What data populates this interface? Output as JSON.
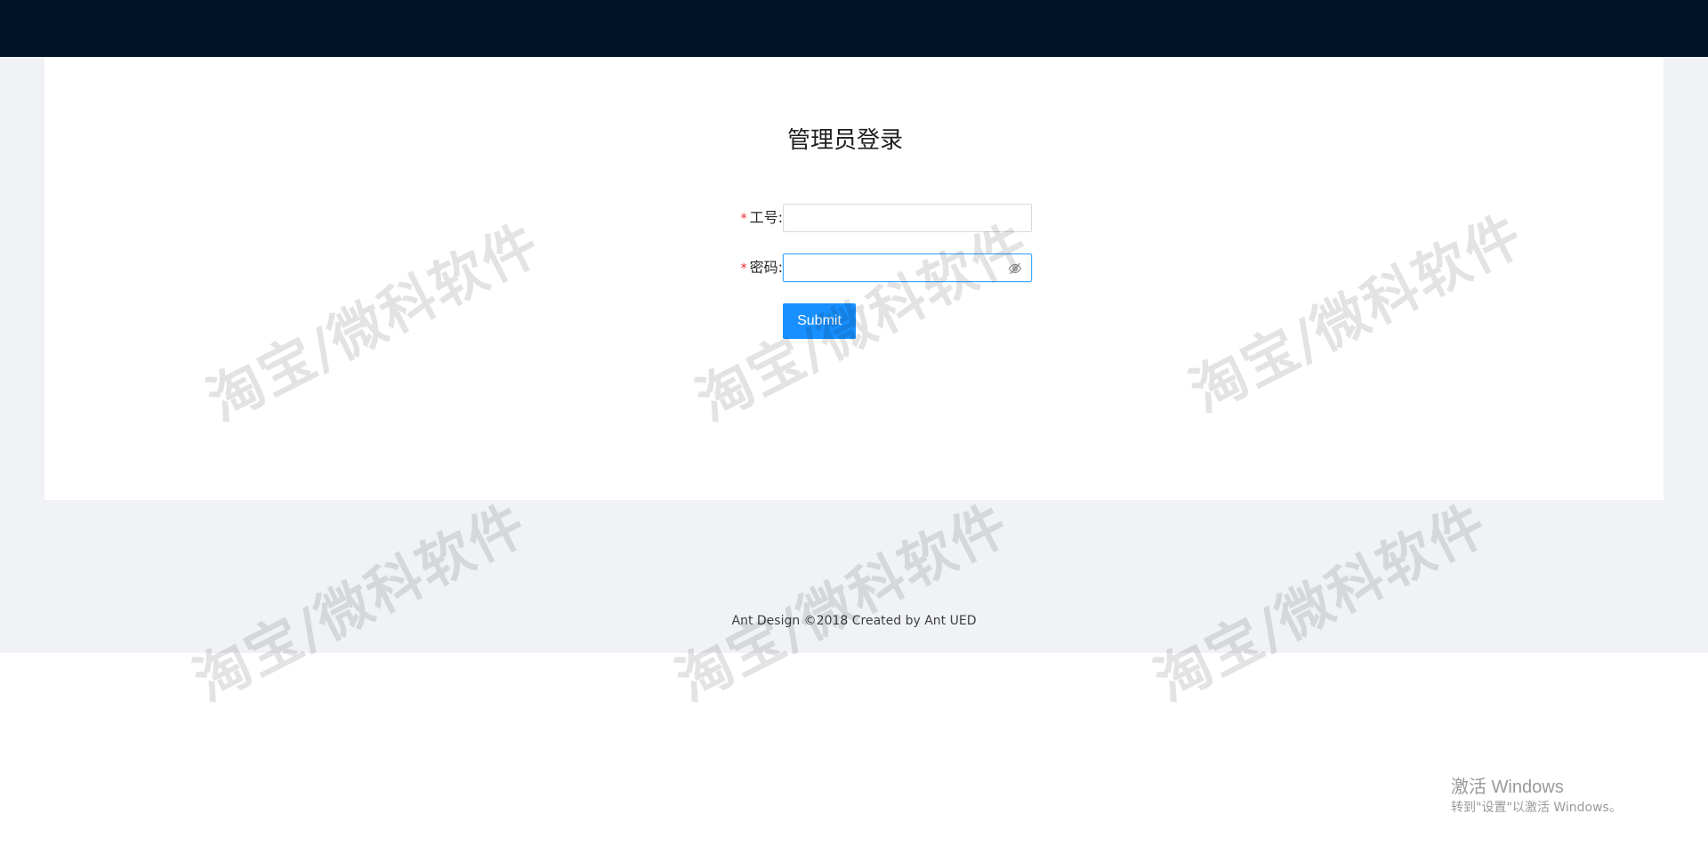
{
  "login": {
    "title": "管理员登录",
    "fields": [
      {
        "required_mark": "*",
        "label": "工号:",
        "value": ""
      },
      {
        "required_mark": "*",
        "label": "密码:",
        "value": "",
        "icon": "eye-invisible-icon"
      }
    ],
    "submit_label": "Submit"
  },
  "footer": {
    "text": "Ant Design ©2018 Created by Ant UED"
  },
  "watermark": {
    "text": "淘宝/微科软件"
  },
  "windows_activation": {
    "title": "激活 Windows",
    "subtitle": "转到\"设置\"以激活 Windows。"
  },
  "colors": {
    "header_bg": "#001529",
    "layout_bg": "#f0f2f5",
    "primary": "#1890ff",
    "required": "#f5222d",
    "focus_border": "#40a9ff"
  }
}
